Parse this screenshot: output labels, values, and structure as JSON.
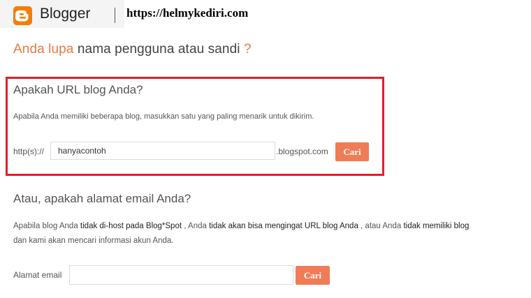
{
  "header": {
    "logo_text": "Blogger",
    "site_url": "https://helmykediri.com",
    "brand_color": "#f57d00"
  },
  "page": {
    "title_part1": "Anda lupa",
    "title_part2": "nama pengguna atau sandi",
    "title_part3": "?"
  },
  "url_section": {
    "heading": "Apakah URL blog Anda?",
    "description": "Apabila Anda memiliki beberapa blog, masukkan satu yang paling menarik untuk dikirim.",
    "prefix": "http(s)://",
    "input_value": "hanyacontoh",
    "suffix": ".blogspot.com",
    "button_label": "Cari"
  },
  "email_section": {
    "heading": "Atau, apakah alamat email Anda?",
    "desc_line1": {
      "p1": "Apabila blog Anda",
      "p2": "tidak di-host pada Blog*Spot",
      "p3": ", Anda",
      "p4": "tidak akan bisa mengingat URL blog Anda",
      "p5": ", atau Anda",
      "p6": "tidak memiliki blog"
    },
    "desc_line2": "dan kami akan mencari informasi akun Anda.",
    "field_label": "Alamat email",
    "input_value": "",
    "button_label": "Cari"
  },
  "colors": {
    "accent_orange": "#e97a43",
    "button": "#ef7c57",
    "highlight_border": "#e02027"
  }
}
